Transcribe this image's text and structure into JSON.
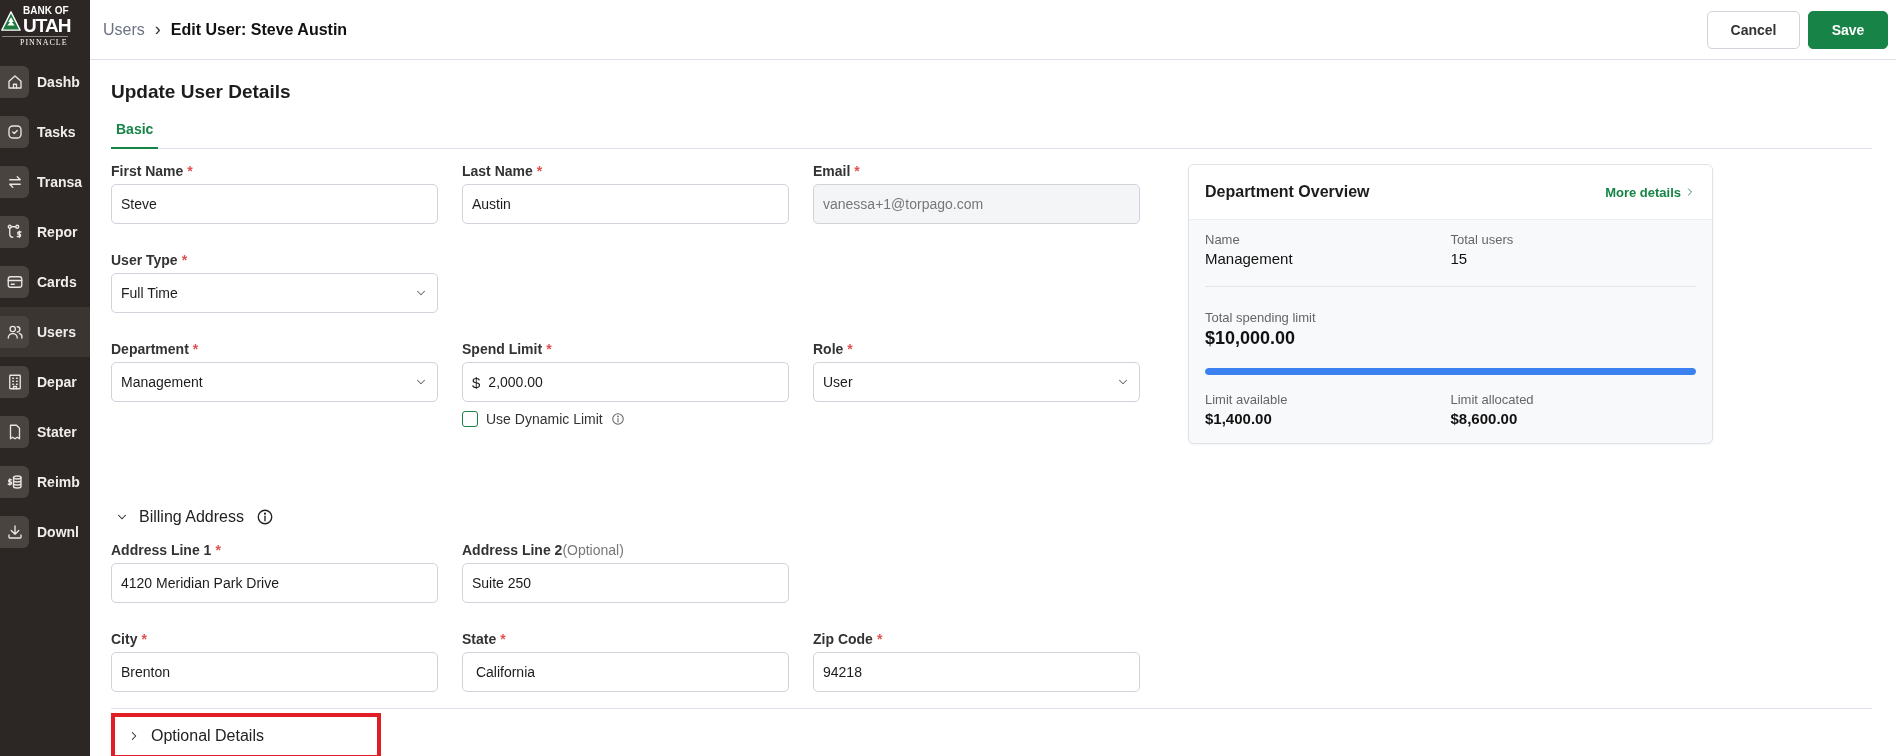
{
  "sidebar": {
    "logo": {
      "top": "BANK OF",
      "main": "UTAH",
      "sub": "PINNACLE"
    },
    "items": [
      {
        "label": "Dashb",
        "selected": false
      },
      {
        "label": "Tasks",
        "selected": false
      },
      {
        "label": "Transa",
        "selected": false
      },
      {
        "label": "Repor",
        "selected": false
      },
      {
        "label": "Cards",
        "selected": false
      },
      {
        "label": "Users",
        "selected": true
      },
      {
        "label": "Depar",
        "selected": false
      },
      {
        "label": "Stater",
        "selected": false
      },
      {
        "label": "Reimb",
        "selected": false
      },
      {
        "label": "Downl",
        "selected": false
      }
    ]
  },
  "header": {
    "breadcrumb": {
      "parent": "Users",
      "separator": "›",
      "current": "Edit User: Steve Austin"
    },
    "buttons": [
      {
        "label": "Cancel",
        "kind": "secondary"
      },
      {
        "label": "Save",
        "kind": "primary"
      }
    ]
  },
  "form": {
    "title": "Update User Details",
    "tabs": [
      {
        "label": "Basic",
        "selected": true
      }
    ],
    "rows": [
      [
        {
          "label": "First Name",
          "mark": "*",
          "kind": "text",
          "value": "Steve"
        },
        {
          "label": "Last Name",
          "mark": "*",
          "kind": "text",
          "value": "Austin"
        },
        {
          "label": "Email",
          "mark": "*",
          "kind": "text",
          "value": "vanessa+1@torpago.com",
          "disabled": true
        }
      ],
      [
        {
          "label": "User Type",
          "mark": "*",
          "kind": "select",
          "value": "Full Time"
        }
      ],
      [
        {
          "label": "Department",
          "mark": "*",
          "kind": "select",
          "value": "Management"
        },
        {
          "label": "Spend Limit",
          "mark": "*",
          "kind": "currency",
          "prefix": "$",
          "value": "2,000.00",
          "checkbox": {
            "label": "Use Dynamic Limit",
            "checked": false
          }
        },
        {
          "label": "Role",
          "mark": "*",
          "kind": "select",
          "value": "User"
        }
      ]
    ]
  },
  "overview": {
    "title": "Department Overview",
    "link": "More details",
    "stats": [
      {
        "label": "Name",
        "value": "Management"
      },
      {
        "label": "Total users",
        "value": "15"
      }
    ],
    "total_label": "Total spending limit",
    "total_value": "$10,000.00",
    "level": 1,
    "limits": [
      {
        "label": "Limit available",
        "value": "$1,400.00"
      },
      {
        "label": "Limit allocated",
        "value": "$8,600.00"
      }
    ]
  },
  "billing": {
    "title": "Billing Address",
    "expanded": true,
    "rows": [
      [
        {
          "label": "Address Line 1",
          "mark": "*",
          "kind": "text",
          "value": "4120 Meridian Park Drive"
        },
        {
          "label": "Address Line 2",
          "hint": "(Optional)",
          "kind": "text",
          "value": "Suite 250"
        }
      ],
      [
        {
          "label": "City",
          "mark": "*",
          "kind": "text",
          "value": "Brenton"
        },
        {
          "label": "State",
          "mark": "*",
          "kind": "text",
          "value": " California"
        },
        {
          "label": "Zip Code",
          "mark": "*",
          "kind": "text",
          "value": "94218"
        }
      ]
    ]
  },
  "optional": {
    "title": "Optional Details",
    "expanded": false,
    "highlighted": true
  }
}
